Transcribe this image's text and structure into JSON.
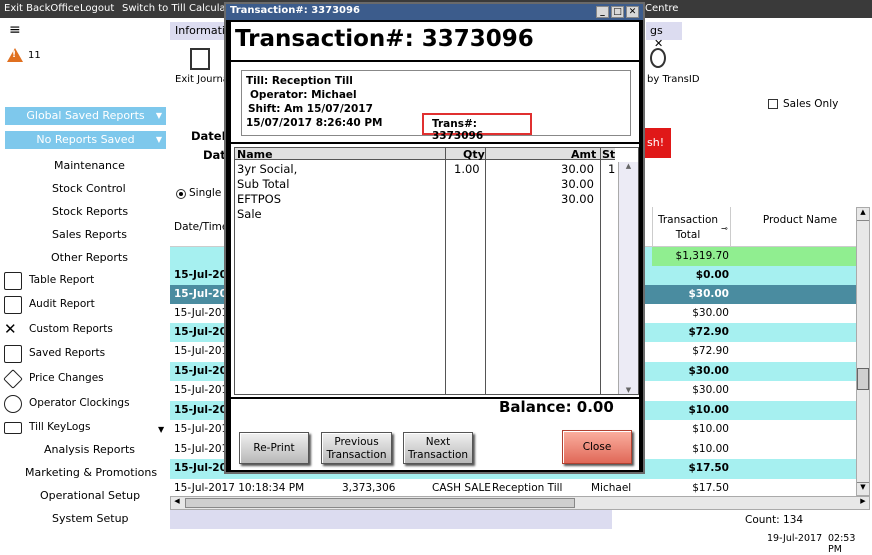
{
  "topbar": {
    "items": [
      "Exit BackOffice",
      "Logout",
      "Switch to Till",
      "Calculat",
      "Centre"
    ]
  },
  "left": {
    "alert_count": "11",
    "global_saved": "Global Saved Reports",
    "no_reports": "No Reports Saved",
    "menu": [
      "Maintenance",
      "Stock Control",
      "Stock Reports",
      "Sales Reports",
      "Other Reports"
    ],
    "nav": [
      "Table Report",
      "Audit Report",
      "Custom Reports",
      "Saved Reports",
      "Price Changes",
      "Operator Clockings",
      "Till KeyLogs"
    ],
    "menu2": [
      "Analysis Reports",
      "Marketing & Promotions",
      "Operational Setup",
      "System Setup"
    ]
  },
  "tabs": {
    "info": "Informatio",
    "gs": "gs",
    "close": "✕"
  },
  "toolbar": {
    "exit_journal": "Exit Journa",
    "by_transid": "by TransID",
    "sales_only": "Sales Only",
    "date_from": "DateF",
    "date": "Dat",
    "flash": "sh!",
    "single": "Single L"
  },
  "grid": {
    "headers": {
      "datetime": "Date/Time",
      "trans_total": "Transaction Total",
      "product": "Product Name"
    },
    "summary_total": "$1,319.70",
    "rows": [
      {
        "date": "15-Jul-201",
        "total": "$0.00"
      },
      {
        "date": "15-Jul-201",
        "total": "$30.00"
      },
      {
        "date": "15-Jul-2017",
        "total": "$30.00"
      },
      {
        "date": "15-Jul-201",
        "total": "$72.90"
      },
      {
        "date": "15-Jul-2017",
        "total": "$72.90"
      },
      {
        "date": "15-Jul-201",
        "total": "$30.00"
      },
      {
        "date": "15-Jul-2017",
        "total": "$30.00"
      },
      {
        "date": "15-Jul-201",
        "total": "$10.00"
      },
      {
        "date": "15-Jul-2017",
        "total": "$10.00"
      },
      {
        "date": "15-Jul-2017",
        "total": "$10.00"
      },
      {
        "date": "15-Jul-201",
        "total": "$17.50"
      }
    ],
    "last_row": {
      "date": "15-Jul-2017 10:18:34 PM",
      "trans": "3,373,306",
      "type": "CASH SALE",
      "till": "Reception Till",
      "operator": "Michael",
      "total": "$17.50"
    },
    "count": "Count: 134",
    "status_date": "19-Jul-2017",
    "status_time": "02:53 PM"
  },
  "dialog": {
    "window_title": "Transaction#: 3373096",
    "heading": "Transaction#: 3373096",
    "till": "Till: Reception Till",
    "operator": "Operator: Michael",
    "shift": "Shift: Am 15/07/2017",
    "datetime": "15/07/2017 8:26:40 PM",
    "trans": "Trans#: 3373096",
    "cols": {
      "name": "Name",
      "qty": "Qty",
      "amt": "Amt",
      "st": "St"
    },
    "lines": [
      {
        "name": "3yr Social,",
        "qty": "1.00",
        "amt": "30.00",
        "st": "1"
      },
      {
        "name": "Sub Total",
        "qty": "",
        "amt": "30.00",
        "st": ""
      },
      {
        "name": "EFTPOS",
        "qty": "",
        "amt": "30.00",
        "st": ""
      },
      {
        "name": "Sale",
        "qty": "",
        "amt": "",
        "st": ""
      }
    ],
    "balance": "Balance: 0.00",
    "reprint": "Re-Print",
    "prev1": "Previous",
    "prev2": "Transaction",
    "next1": "Next",
    "next2": "Transaction",
    "close": "Close"
  },
  "colors": {
    "cyan_row": "#a6f0f0",
    "selected_row": "#4a8ca0",
    "green_row": "#90ee90",
    "saved_btn": "#7ec8ec",
    "close_btn": "#f08070"
  }
}
